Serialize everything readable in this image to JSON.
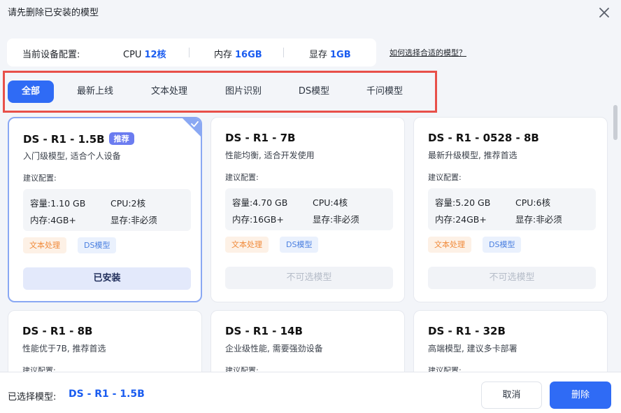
{
  "dialog": {
    "title": "请先删除已安装的模型"
  },
  "device": {
    "label": "当前设备配置:",
    "cpu": {
      "label": "CPU",
      "value": "12核"
    },
    "memory": {
      "label": "内存",
      "value": "16GB"
    },
    "vram": {
      "label": "显存",
      "value": "1GB"
    },
    "help_link": "如何选择合适的模型？"
  },
  "tabs": [
    "全部",
    "最新上线",
    "文本处理",
    "图片识别",
    "DS模型",
    "千问模型"
  ],
  "active_tab": "全部",
  "colors": {
    "accent": "#2f6bf5",
    "highlight_border": "#e8504a",
    "text_tag": "#f08a3a",
    "ds_tag": "#4a7fe0"
  },
  "spec_labels": {
    "capacity": "容量:",
    "cpu": "CPU:",
    "memory": "内存:",
    "vram": "显存:"
  },
  "suggest_label": "建议配置:",
  "models": [
    {
      "name": "DS - R1 - 1.5B",
      "badge": "推荐",
      "desc": "入门级模型, 适合个人设备",
      "capacity": "1.10 GB",
      "cpu": "2核",
      "memory": "4GB+",
      "vram": "非必须",
      "tags": [
        "文本处理",
        "DS模型"
      ],
      "button": "已安装",
      "state": "installed"
    },
    {
      "name": "DS - R1 - 7B",
      "badge": "",
      "desc": "性能均衡, 适合开发使用",
      "capacity": "4.70 GB",
      "cpu": "4核",
      "memory": "16GB+",
      "vram": "非必须",
      "tags": [
        "文本处理",
        "DS模型"
      ],
      "button": "不可选模型",
      "state": "disabled"
    },
    {
      "name": "DS - R1 - 0528 - 8B",
      "badge": "",
      "desc": "最新升级模型, 推荐首选",
      "capacity": "5.20 GB",
      "cpu": "6核",
      "memory": "24GB+",
      "vram": "非必须",
      "tags": [
        "文本处理",
        "DS模型"
      ],
      "button": "不可选模型",
      "state": "disabled"
    },
    {
      "name": "DS - R1 - 8B",
      "badge": "",
      "desc": "性能优于7B, 推荐首选"
    },
    {
      "name": "DS - R1 - 14B",
      "badge": "",
      "desc": "企业级性能, 需要强劲设备"
    },
    {
      "name": "DS - R1 - 32B",
      "badge": "",
      "desc": "高端模型, 建议多卡部署"
    }
  ],
  "footer": {
    "selected_label": "已选择模型:",
    "selected_model": "DS - R1 - 1.5B",
    "cancel": "取消",
    "delete": "删除"
  }
}
